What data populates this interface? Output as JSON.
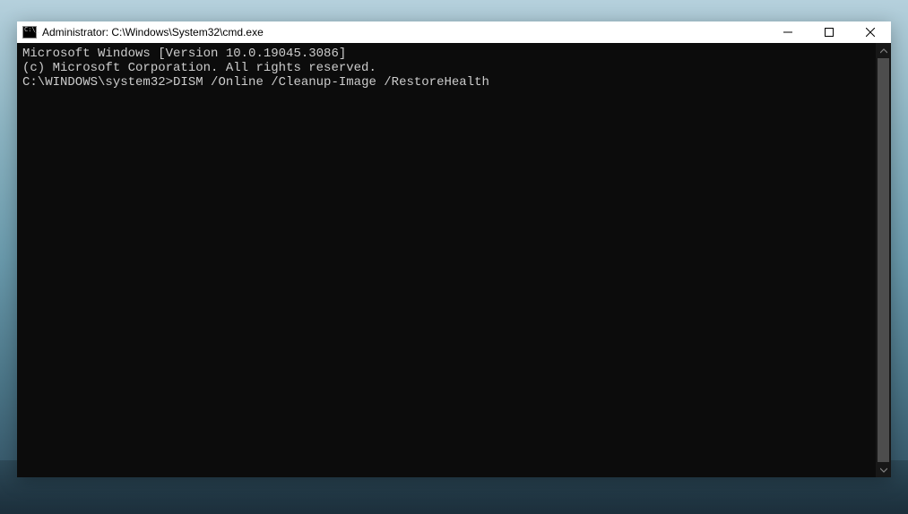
{
  "window": {
    "title": "Administrator: C:\\Windows\\System32\\cmd.exe"
  },
  "terminal": {
    "line1": "Microsoft Windows [Version 10.0.19045.3086]",
    "line2": "(c) Microsoft Corporation. All rights reserved.",
    "blank": "",
    "prompt": "C:\\WINDOWS\\system32>",
    "command": "DISM /Online /Cleanup-Image /RestoreHealth"
  }
}
